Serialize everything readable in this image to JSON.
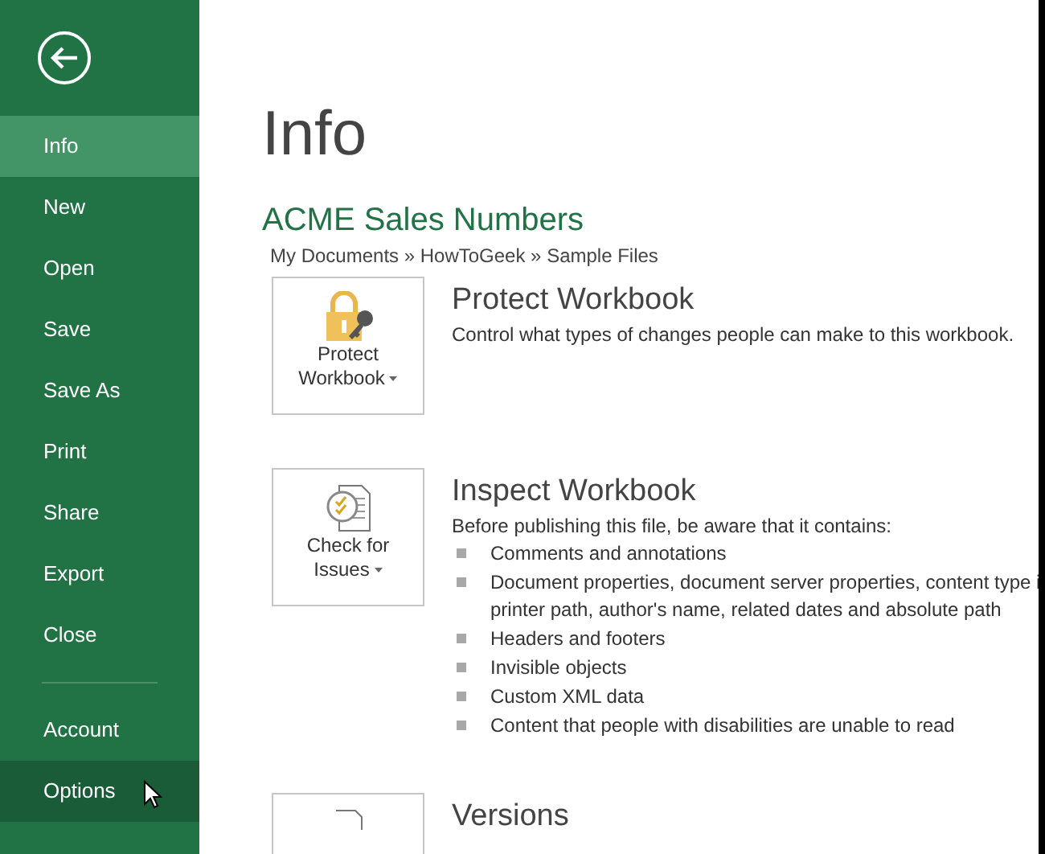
{
  "sidebar": {
    "items": [
      {
        "label": "Info",
        "selected": true,
        "hovered": false
      },
      {
        "label": "New",
        "selected": false,
        "hovered": false
      },
      {
        "label": "Open",
        "selected": false,
        "hovered": false
      },
      {
        "label": "Save",
        "selected": false,
        "hovered": false
      },
      {
        "label": "Save As",
        "selected": false,
        "hovered": false
      },
      {
        "label": "Print",
        "selected": false,
        "hovered": false
      },
      {
        "label": "Share",
        "selected": false,
        "hovered": false
      },
      {
        "label": "Export",
        "selected": false,
        "hovered": false
      },
      {
        "label": "Close",
        "selected": false,
        "hovered": false
      }
    ],
    "bottom_items": [
      {
        "label": "Account",
        "selected": false,
        "hovered": false
      },
      {
        "label": "Options",
        "selected": false,
        "hovered": true
      }
    ]
  },
  "page_title": "Info",
  "file_name": "ACME Sales Numbers",
  "file_path": "My Documents » HowToGeek » Sample Files",
  "sections": [
    {
      "kind": "lock",
      "button_lines": [
        "Protect",
        "Workbook"
      ],
      "heading": "Protect Workbook",
      "description": "Control what types of changes people can make to this workbook."
    },
    {
      "kind": "inspect",
      "button_lines": [
        "Check for",
        "Issues"
      ],
      "heading": "Inspect Workbook",
      "description": "Before publishing this file, be aware that it contains:",
      "bullets": [
        {
          "lines": [
            "Comments and annotations"
          ]
        },
        {
          "lines": [
            "Document properties, document server properties, content type i",
            "printer path, author's name, related dates and absolute path"
          ]
        },
        {
          "lines": [
            "Headers and footers"
          ]
        },
        {
          "lines": [
            "Invisible objects"
          ]
        },
        {
          "lines": [
            "Custom XML data"
          ]
        },
        {
          "lines": [
            "Content that people with disabilities are unable to read"
          ]
        }
      ]
    },
    {
      "kind": "versions",
      "heading": "Versions"
    }
  ]
}
